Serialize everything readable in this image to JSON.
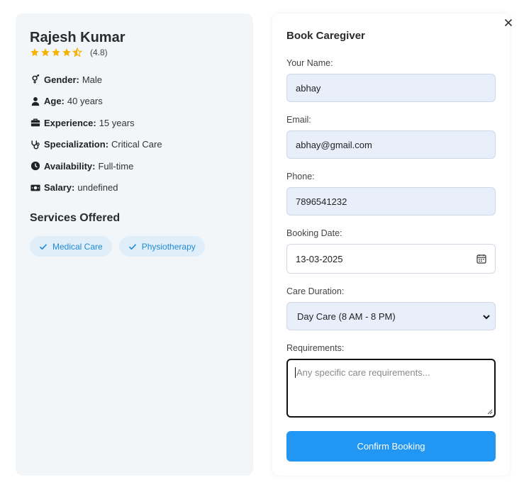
{
  "caregiver": {
    "name": "Rajesh Kumar",
    "rating_text": "(4.8)",
    "rating_value": 4.8,
    "star_color": "#f5b301",
    "details": [
      {
        "icon": "gender-icon",
        "label": "Gender:",
        "value": "Male"
      },
      {
        "icon": "user-icon",
        "label": "Age:",
        "value": "40 years"
      },
      {
        "icon": "briefcase-icon",
        "label": "Experience:",
        "value": "15 years"
      },
      {
        "icon": "stethoscope-icon",
        "label": "Specialization:",
        "value": "Critical Care"
      },
      {
        "icon": "clock-icon",
        "label": "Availability:",
        "value": "Full-time"
      },
      {
        "icon": "money-icon",
        "label": "Salary:",
        "value": "undefined"
      }
    ]
  },
  "services": {
    "title": "Services Offered",
    "items": [
      "Medical Care",
      "Physiotherapy"
    ],
    "chip_color": "#1f8ad6"
  },
  "form": {
    "title": "Book Caregiver",
    "name_label": "Your Name:",
    "name_value": "abhay",
    "email_label": "Email:",
    "email_value": "abhay@gmail.com",
    "phone_label": "Phone:",
    "phone_value": "7896541232",
    "date_label": "Booking Date:",
    "date_value": "13-03-2025",
    "duration_label": "Care Duration:",
    "duration_value": "Day Care (8 AM - 8 PM)",
    "requirements_label": "Requirements:",
    "requirements_placeholder": "Any specific care requirements...",
    "confirm_label": "Confirm Booking",
    "accent_color": "#2196f3"
  }
}
